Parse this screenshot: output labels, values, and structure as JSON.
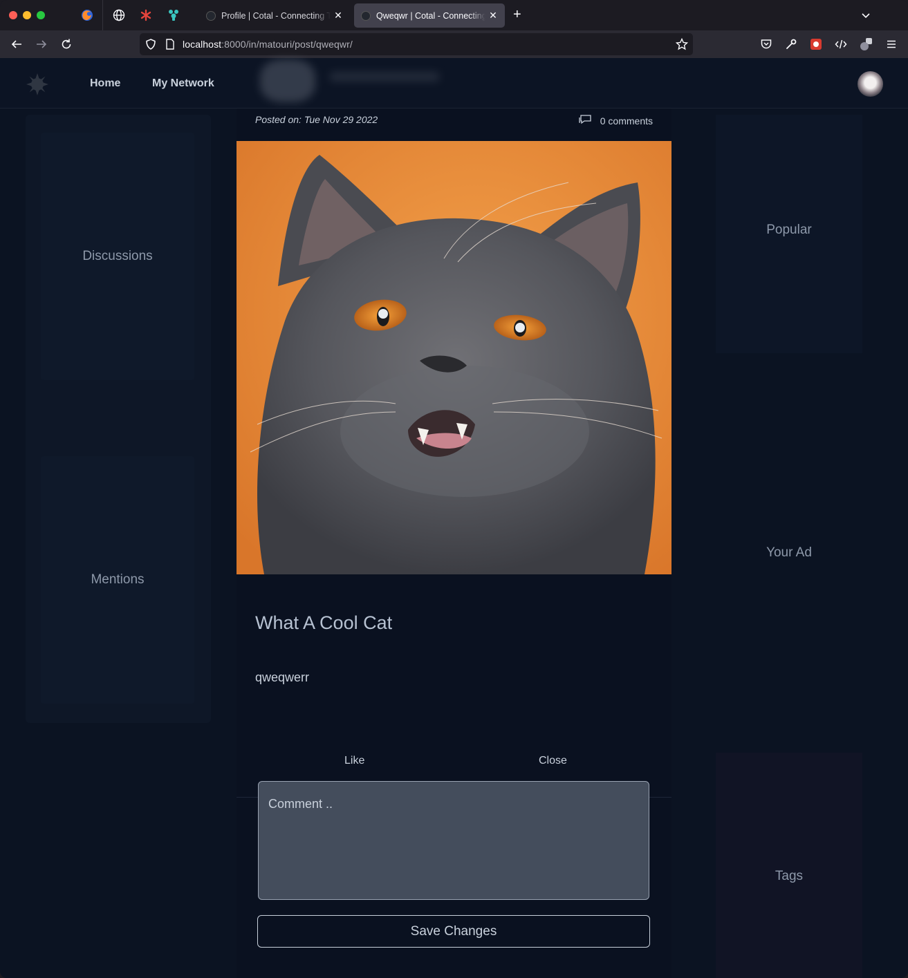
{
  "browser": {
    "tabs": [
      {
        "title": "Profile | Cotal - Connecting Talent",
        "active": false
      },
      {
        "title": "Qweqwr | Cotal - Connecting Talent",
        "active": true
      }
    ],
    "url": {
      "host": "localhost",
      "rest": ":8000/in/matouri/post/qweqwr/"
    },
    "icons": [
      "back-icon",
      "forward-icon",
      "reload-icon",
      "shield-icon",
      "page-icon",
      "bookmark-star-icon",
      "pocket-icon",
      "wrench-icon",
      "extension-icon",
      "devtools-icon",
      "profile-switch-icon",
      "menu-icon"
    ]
  },
  "nav": {
    "home": "Home",
    "network": "My Network"
  },
  "sidebar": {
    "discussions": "Discussions",
    "mentions": "Mentions"
  },
  "rightbar": {
    "popular": "Popular",
    "ad": "Your Ad",
    "tags": "Tags"
  },
  "post": {
    "posted_on": "Posted on: Tue Nov 29 2022",
    "comments": "0 comments",
    "title": "What A Cool Cat",
    "body": "qweqwerr",
    "like": "Like",
    "close": "Close",
    "comment_placeholder": "Comment ..",
    "save": "Save Changes",
    "image_alt": "gray cat on orange background"
  },
  "colors": {
    "page_bg": "#0b1322",
    "photo_bg": "#e38b37",
    "text": "#c9d1dc"
  }
}
